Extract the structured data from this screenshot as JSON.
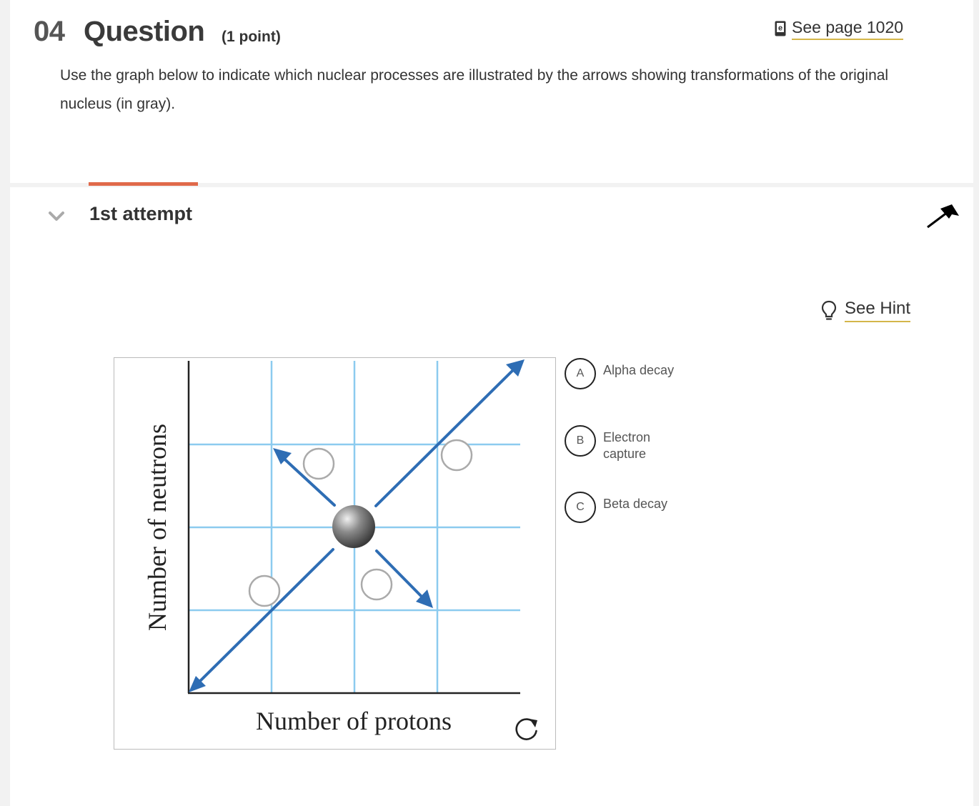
{
  "question": {
    "number": "04",
    "title": "Question",
    "points": "(1 point)",
    "see_page_label": "See page 1020",
    "prompt": "Use the graph below to indicate which nuclear processes are illustrated by the arrows showing transformations of the original nucleus (in gray)."
  },
  "attempt": {
    "label": "1st attempt",
    "hint_label": "See Hint"
  },
  "graph": {
    "x_axis_label": "Number of protons",
    "y_axis_label": "Number of neutrons"
  },
  "choices": [
    {
      "letter": "A",
      "label": "Alpha decay"
    },
    {
      "letter": "B",
      "label": "Electron capture"
    },
    {
      "letter": "C",
      "label": "Beta decay"
    }
  ],
  "colors": {
    "accent_tab": "#e0694a",
    "link_underline": "#d4b64a",
    "arrow_blue": "#2e6db4",
    "grid_blue": "#8ccbef"
  },
  "icons": [
    "ebook-icon",
    "chevron-down-icon",
    "arrow-cursor-icon",
    "lightbulb-icon",
    "reset-icon"
  ]
}
